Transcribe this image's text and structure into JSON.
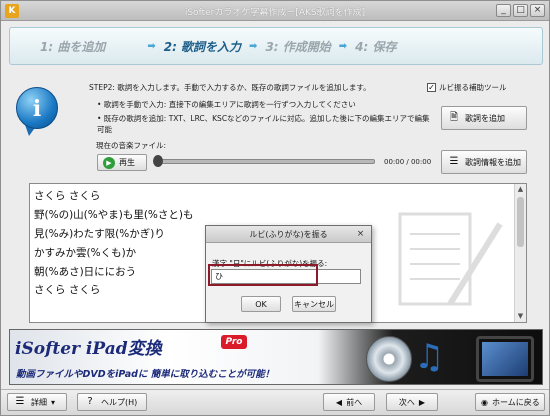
{
  "window": {
    "title": "iSofterカラオケ字幕作成－[AKS歌詞を作成]",
    "controls": [
      "_",
      "□",
      "×"
    ]
  },
  "steps": [
    {
      "label": "1: 曲を追加",
      "active": false
    },
    {
      "label": "2: 歌詞を入力",
      "active": true
    },
    {
      "label": "3: 作成開始",
      "active": false
    },
    {
      "label": "4: 保存",
      "active": false
    }
  ],
  "step_arrow": "➡",
  "info": {
    "icon_letter": "i",
    "step2_desc": "STEP2: 歌詞を入力します。手動で入力するか、既存の歌詞ファイルを追加します。",
    "bullet1": "• 歌詞を手動で入力: 直接下の編集エリアに歌詞を一行ずつ入力してください",
    "bullet2": "• 既存の歌詞を追加: TXT、LRC、KSCなどのファイルに対応。追加した後に下の編集エリアで編集可能",
    "current_music_label": "現在の音楽ファイル:"
  },
  "options": {
    "ruby_tool_label": "ルビ振る補助ツール",
    "ruby_tool_checked": true,
    "check_mark": "✓"
  },
  "buttons": {
    "add_lyrics": "歌詞を追加",
    "add_lyrics_info": "歌詞情報を追加",
    "play": "再生"
  },
  "player": {
    "time": "00:00 / 00:00",
    "progress": 0
  },
  "lyrics": [
    "さくら さくら",
    "野(%の)山(%やま)も里(%さと)も",
    "見(%み)わたす限(%かぎ)り",
    "かすみか雲(%くも)か",
    "朝(%あさ)日ににおう",
    "さくら さくら"
  ],
  "dialog": {
    "title": "ルビ(ふりがな)を振る",
    "close": "×",
    "prompt": "漢字 \"日\"にルビ(ふりがな)を振る:",
    "input_value": "ひ",
    "ok": "OK",
    "cancel": "キャンセル"
  },
  "banner": {
    "brand": "iSofter iPad変換",
    "pro": "Pro",
    "tagline": "動画ファイルやDVDをiPadに 簡単に取り込むことが可能！"
  },
  "bottom": {
    "detail": "詳細",
    "help": "ヘルプ(H)",
    "prev": "前へ",
    "next": "次へ",
    "home": "ホームに戻る"
  },
  "colors": {
    "step_active": "#1d5f8a",
    "step_inactive": "#9aa6ad",
    "dialog_highlight": "#8c1a28",
    "brand_blue": "#1c2a7a"
  }
}
